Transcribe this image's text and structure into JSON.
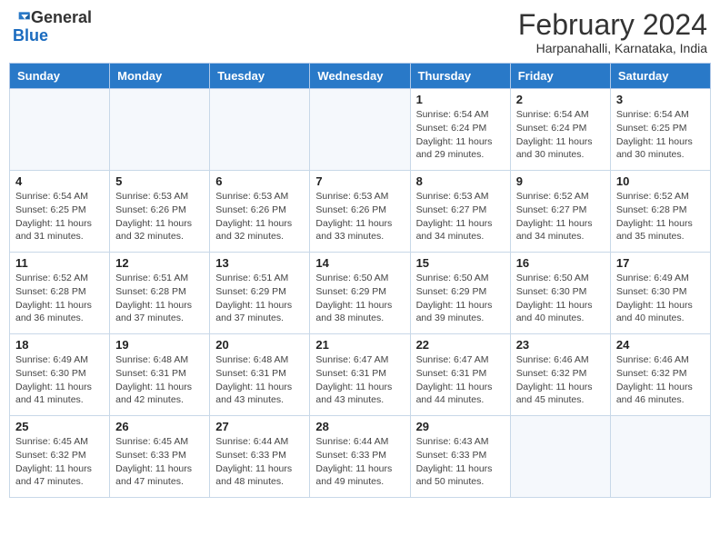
{
  "header": {
    "logo_general": "General",
    "logo_blue": "Blue",
    "title": "February 2024",
    "subtitle": "Harpanahalli, Karnataka, India"
  },
  "weekdays": [
    "Sunday",
    "Monday",
    "Tuesday",
    "Wednesday",
    "Thursday",
    "Friday",
    "Saturday"
  ],
  "weeks": [
    [
      {
        "day": "",
        "info": ""
      },
      {
        "day": "",
        "info": ""
      },
      {
        "day": "",
        "info": ""
      },
      {
        "day": "",
        "info": ""
      },
      {
        "day": "1",
        "info": "Sunrise: 6:54 AM\nSunset: 6:24 PM\nDaylight: 11 hours and 29 minutes."
      },
      {
        "day": "2",
        "info": "Sunrise: 6:54 AM\nSunset: 6:24 PM\nDaylight: 11 hours and 30 minutes."
      },
      {
        "day": "3",
        "info": "Sunrise: 6:54 AM\nSunset: 6:25 PM\nDaylight: 11 hours and 30 minutes."
      }
    ],
    [
      {
        "day": "4",
        "info": "Sunrise: 6:54 AM\nSunset: 6:25 PM\nDaylight: 11 hours and 31 minutes."
      },
      {
        "day": "5",
        "info": "Sunrise: 6:53 AM\nSunset: 6:26 PM\nDaylight: 11 hours and 32 minutes."
      },
      {
        "day": "6",
        "info": "Sunrise: 6:53 AM\nSunset: 6:26 PM\nDaylight: 11 hours and 32 minutes."
      },
      {
        "day": "7",
        "info": "Sunrise: 6:53 AM\nSunset: 6:26 PM\nDaylight: 11 hours and 33 minutes."
      },
      {
        "day": "8",
        "info": "Sunrise: 6:53 AM\nSunset: 6:27 PM\nDaylight: 11 hours and 34 minutes."
      },
      {
        "day": "9",
        "info": "Sunrise: 6:52 AM\nSunset: 6:27 PM\nDaylight: 11 hours and 34 minutes."
      },
      {
        "day": "10",
        "info": "Sunrise: 6:52 AM\nSunset: 6:28 PM\nDaylight: 11 hours and 35 minutes."
      }
    ],
    [
      {
        "day": "11",
        "info": "Sunrise: 6:52 AM\nSunset: 6:28 PM\nDaylight: 11 hours and 36 minutes."
      },
      {
        "day": "12",
        "info": "Sunrise: 6:51 AM\nSunset: 6:28 PM\nDaylight: 11 hours and 37 minutes."
      },
      {
        "day": "13",
        "info": "Sunrise: 6:51 AM\nSunset: 6:29 PM\nDaylight: 11 hours and 37 minutes."
      },
      {
        "day": "14",
        "info": "Sunrise: 6:50 AM\nSunset: 6:29 PM\nDaylight: 11 hours and 38 minutes."
      },
      {
        "day": "15",
        "info": "Sunrise: 6:50 AM\nSunset: 6:29 PM\nDaylight: 11 hours and 39 minutes."
      },
      {
        "day": "16",
        "info": "Sunrise: 6:50 AM\nSunset: 6:30 PM\nDaylight: 11 hours and 40 minutes."
      },
      {
        "day": "17",
        "info": "Sunrise: 6:49 AM\nSunset: 6:30 PM\nDaylight: 11 hours and 40 minutes."
      }
    ],
    [
      {
        "day": "18",
        "info": "Sunrise: 6:49 AM\nSunset: 6:30 PM\nDaylight: 11 hours and 41 minutes."
      },
      {
        "day": "19",
        "info": "Sunrise: 6:48 AM\nSunset: 6:31 PM\nDaylight: 11 hours and 42 minutes."
      },
      {
        "day": "20",
        "info": "Sunrise: 6:48 AM\nSunset: 6:31 PM\nDaylight: 11 hours and 43 minutes."
      },
      {
        "day": "21",
        "info": "Sunrise: 6:47 AM\nSunset: 6:31 PM\nDaylight: 11 hours and 43 minutes."
      },
      {
        "day": "22",
        "info": "Sunrise: 6:47 AM\nSunset: 6:31 PM\nDaylight: 11 hours and 44 minutes."
      },
      {
        "day": "23",
        "info": "Sunrise: 6:46 AM\nSunset: 6:32 PM\nDaylight: 11 hours and 45 minutes."
      },
      {
        "day": "24",
        "info": "Sunrise: 6:46 AM\nSunset: 6:32 PM\nDaylight: 11 hours and 46 minutes."
      }
    ],
    [
      {
        "day": "25",
        "info": "Sunrise: 6:45 AM\nSunset: 6:32 PM\nDaylight: 11 hours and 47 minutes."
      },
      {
        "day": "26",
        "info": "Sunrise: 6:45 AM\nSunset: 6:33 PM\nDaylight: 11 hours and 47 minutes."
      },
      {
        "day": "27",
        "info": "Sunrise: 6:44 AM\nSunset: 6:33 PM\nDaylight: 11 hours and 48 minutes."
      },
      {
        "day": "28",
        "info": "Sunrise: 6:44 AM\nSunset: 6:33 PM\nDaylight: 11 hours and 49 minutes."
      },
      {
        "day": "29",
        "info": "Sunrise: 6:43 AM\nSunset: 6:33 PM\nDaylight: 11 hours and 50 minutes."
      },
      {
        "day": "",
        "info": ""
      },
      {
        "day": "",
        "info": ""
      }
    ]
  ]
}
